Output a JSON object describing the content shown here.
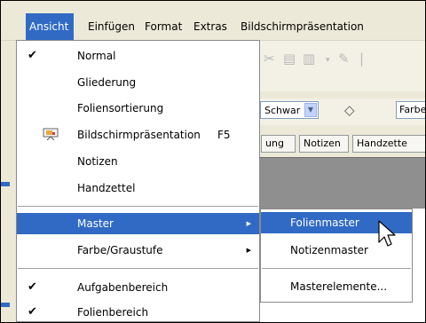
{
  "menubar": {
    "items": [
      {
        "label": "Ansicht",
        "active": true
      },
      {
        "label": "Einfügen"
      },
      {
        "label": "Format"
      },
      {
        "label": "Extras"
      },
      {
        "label": "Bildschirmpräsentation"
      }
    ]
  },
  "background": {
    "font_combo_value": "Schwar",
    "color_field_value": "Farbe",
    "tabs": [
      "ung",
      "Notizen",
      "Handzette"
    ]
  },
  "ansicht_menu": {
    "items": [
      {
        "label": "Normal",
        "checked": true
      },
      {
        "label": "Gliederung"
      },
      {
        "label": "Foliensortierung"
      },
      {
        "label": "Bildschirmpräsentation",
        "shortcut": "F5",
        "icon": "presentation-icon"
      },
      {
        "label": "Notizen"
      },
      {
        "label": "Handzettel"
      },
      {
        "label": "Master",
        "submenu": true,
        "highlighted": true
      },
      {
        "label": "Farbe/Graustufe",
        "submenu": true
      },
      {
        "label": "Aufgabenbereich",
        "checked": true
      },
      {
        "label": "Folienbereich",
        "checked": true
      }
    ]
  },
  "master_submenu": {
    "items": [
      {
        "label": "Folienmaster",
        "highlighted": true
      },
      {
        "label": "Notizenmaster"
      },
      {
        "label": "Masterelemente..."
      }
    ]
  },
  "colors": {
    "highlight": "#316ac5",
    "menubar": "#ece9d8",
    "menu_bg": "#ffffff"
  }
}
